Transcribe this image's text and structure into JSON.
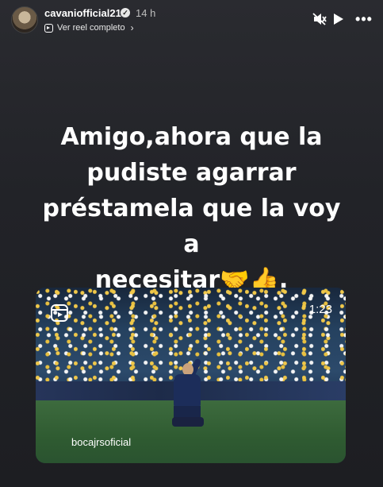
{
  "header": {
    "username": "cavaniofficial21",
    "verified_icon": "verified-badge-icon",
    "time": "14 h",
    "reel_link_label": "Ver reel completo",
    "controls": [
      "mute-icon",
      "play-icon",
      "more-options-icon"
    ]
  },
  "caption": {
    "lines": [
      "Amigo,ahora que la",
      "pudiste agarrar",
      "préstamela que la voy a",
      "necesitar🤝👍."
    ]
  },
  "reel_card": {
    "reel_icon": "reels-icon",
    "duration": "1:23",
    "account": "bocajrsoficial"
  }
}
